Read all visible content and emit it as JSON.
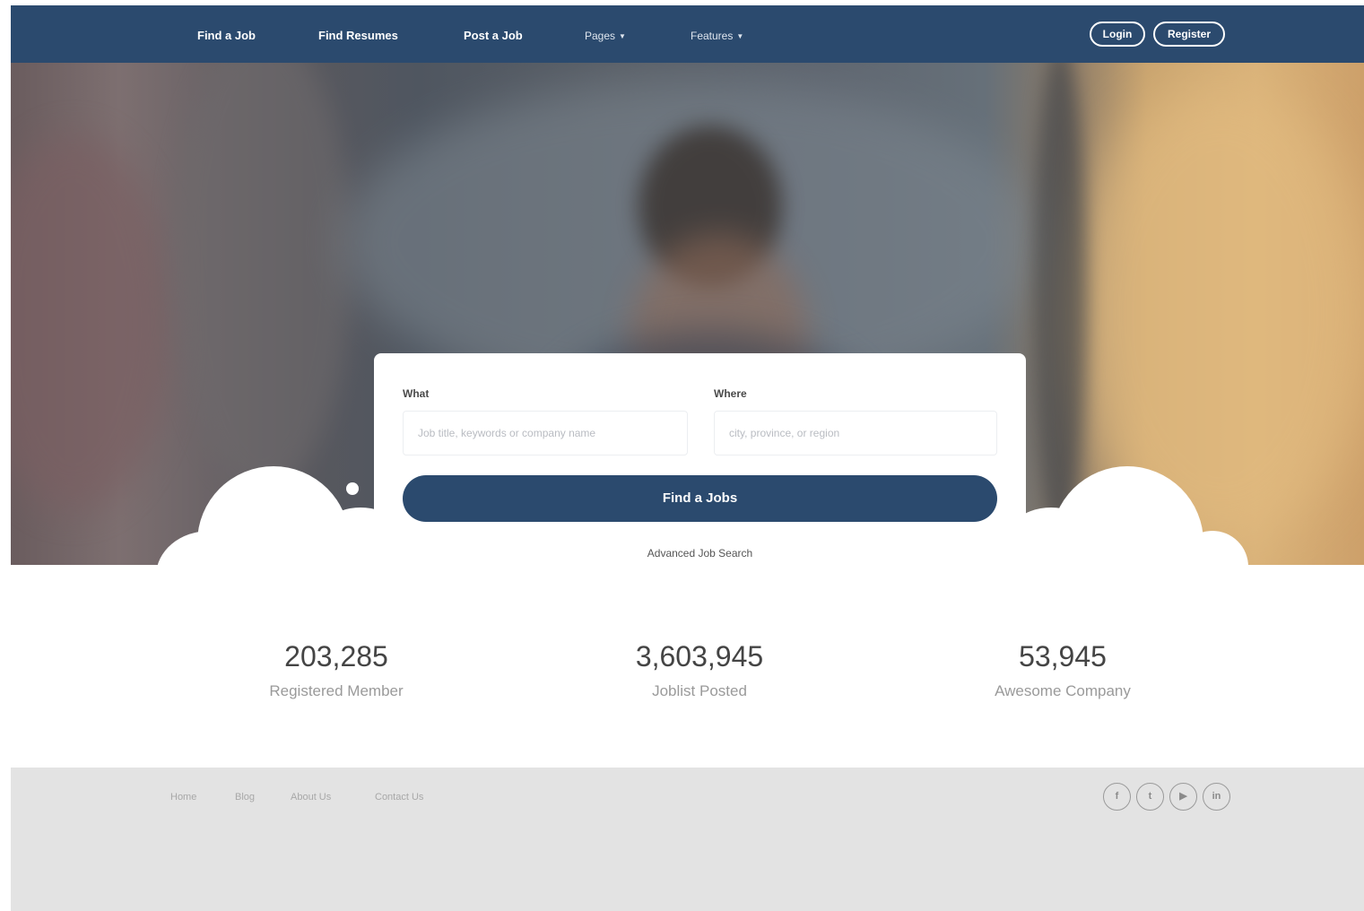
{
  "nav": {
    "find_job": "Find a Job",
    "find_resumes": "Find Resumes",
    "post_job": "Post a Job",
    "pages": "Pages",
    "features": "Features",
    "login": "Login",
    "register": "Register"
  },
  "search": {
    "what_label": "What",
    "what_placeholder": "Job title, keywords or company name",
    "where_label": "Where",
    "where_placeholder": "city, province, or region",
    "button_label": "Find a Jobs",
    "advanced_link": "Advanced Job Search"
  },
  "stats": [
    {
      "value": "203,285",
      "label": "Registered Member"
    },
    {
      "value": "3,603,945",
      "label": "Joblist Posted"
    },
    {
      "value": "53,945",
      "label": "Awesome Company"
    }
  ],
  "footer": {
    "links": [
      "Home",
      "Blog",
      "About Us",
      "Contact Us"
    ],
    "social": [
      {
        "icon": "facebook-icon",
        "glyph": "f"
      },
      {
        "icon": "twitter-icon",
        "glyph": "t"
      },
      {
        "icon": "youtube-icon",
        "glyph": "▶"
      },
      {
        "icon": "linkedin-icon",
        "glyph": "in"
      }
    ]
  },
  "colors": {
    "brand": "#2b4a6e",
    "footer_bg": "#e3e3e3"
  }
}
